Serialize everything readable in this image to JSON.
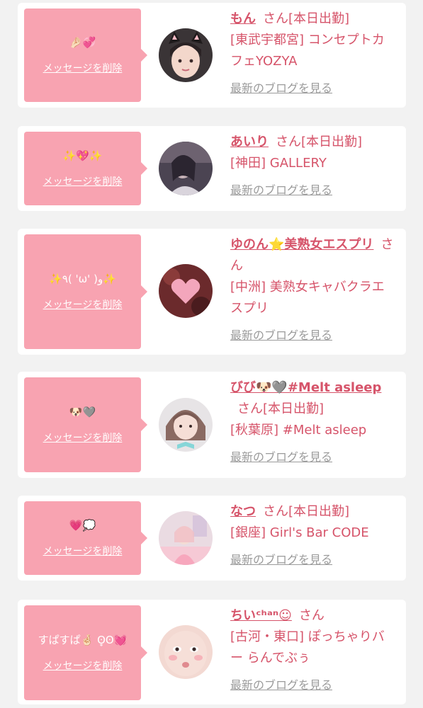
{
  "delete_label": "メッセージを削除",
  "blog_label": "最新のブログを見る",
  "san_label": "さん",
  "cards": [
    {
      "message": "🤌🏻💞",
      "name": "もん",
      "status": "[本日出勤]",
      "shop": "[東武宇都宮] コンセプトカフェYOZYA",
      "avatar_icon": "girl-cat-ears-avatar"
    },
    {
      "message": "✨💖✨",
      "name": "あいり",
      "status": "[本日出勤]",
      "shop": "[神田] GALLERY",
      "avatar_icon": "dim-lit-portrait-avatar"
    },
    {
      "message": "✨٩( 'ω' )و✨",
      "name": "ゆのん⭐美熟女エスプリ",
      "status": "",
      "shop": "[中洲] 美熟女キャバクラエスプリ",
      "avatar_icon": "pink-heart-photo-avatar"
    },
    {
      "message": "🐶🩶",
      "name": "びび🐶🩶#Melt asleep",
      "status": "[本日出勤]",
      "shop": "[秋葉原] #Melt asleep",
      "avatar_icon": "girl-ribbon-avatar"
    },
    {
      "message": "💗💭",
      "name": "なつ",
      "status": "[本日出勤]",
      "shop": "[銀座] Girl's Bar CODE",
      "avatar_icon": "pastel-room-avatar"
    },
    {
      "message": "すぱすぱ🤞🏻 ʘ̥ʘ💓",
      "name": "ちいᶜʰᵃⁿ☺︎",
      "status": "",
      "shop": "[古河・東口] ぽっちゃりバー らんでぶぅ",
      "avatar_icon": "close-up-face-avatar"
    }
  ],
  "colors": {
    "accent": "#d6546a",
    "bubble": "#f8a3b1",
    "muted": "#9b9b9b",
    "page_bg": "#f2f2f2"
  }
}
